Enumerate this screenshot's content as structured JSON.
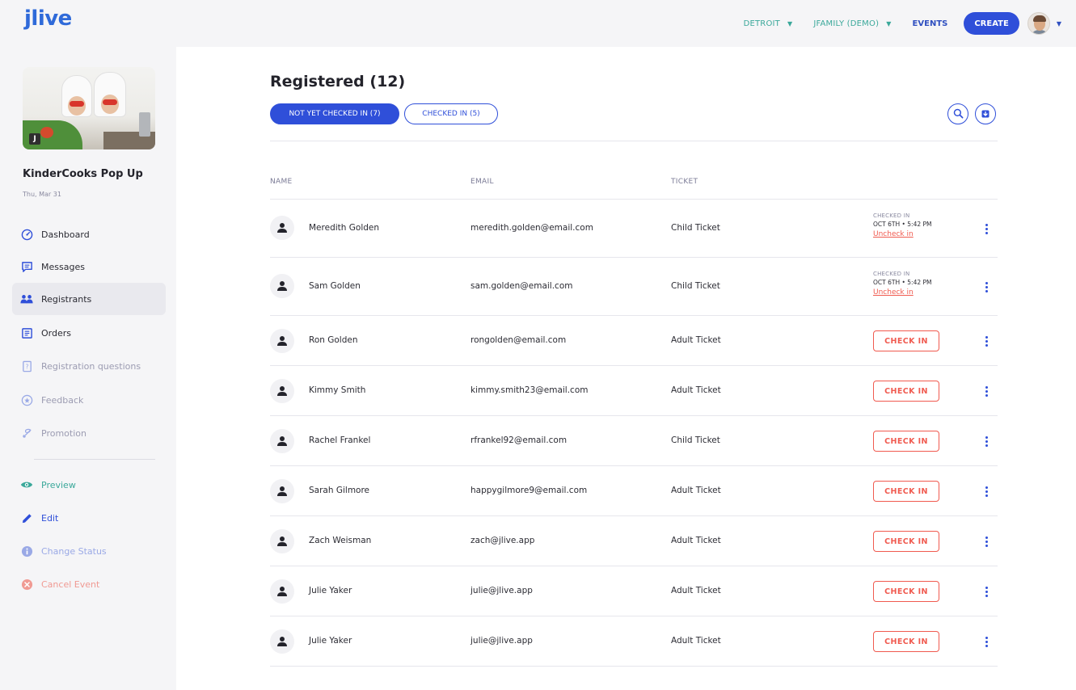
{
  "header": {
    "logo": "jlive",
    "city_label": "DETROIT",
    "account_label": "JFAMILY (DEMO)",
    "events_label": "EVENTS",
    "create_label": "CREATE"
  },
  "sidebar": {
    "event_title": "KinderCooks Pop Up",
    "event_date": "Thu, Mar 31",
    "image_badge": "J",
    "items": [
      {
        "label": "Dashboard",
        "icon": "dashboard-icon"
      },
      {
        "label": "Messages",
        "icon": "message-icon"
      },
      {
        "label": "Registrants",
        "icon": "people-icon",
        "active": true
      },
      {
        "label": "Orders",
        "icon": "orders-icon"
      },
      {
        "label": "Registration questions",
        "icon": "question-icon"
      },
      {
        "label": "Feedback",
        "icon": "feedback-icon"
      },
      {
        "label": "Promotion",
        "icon": "promotion-icon"
      }
    ],
    "actions": [
      {
        "label": "Preview",
        "icon": "eye-icon",
        "color": "#3aa89a"
      },
      {
        "label": "Edit",
        "icon": "pencil-icon",
        "color": "#2f4fd9"
      },
      {
        "label": "Change Status",
        "icon": "info-icon",
        "color": "#9aa9e6"
      },
      {
        "label": "Cancel Event",
        "icon": "cancel-icon",
        "color": "#f09a93"
      }
    ]
  },
  "main": {
    "title": "Registered (12)",
    "tabs": {
      "not_checked_in": "NOT YET CHECKED IN (7)",
      "checked_in": "CHECKED IN (5)"
    },
    "columns": {
      "name": "NAME",
      "email": "EMAIL",
      "ticket": "TICKET"
    },
    "checkin_label": "CHECK IN",
    "checked_in_label": "CHECKED IN",
    "uncheck_label": "Uncheck in",
    "rows": [
      {
        "name": "Meredith Golden",
        "email": "meredith.golden@email.com",
        "ticket": "Child Ticket",
        "status": "checked",
        "checked_at": "OCT 6TH • 5:42 PM"
      },
      {
        "name": "Sam Golden",
        "email": "sam.golden@email.com",
        "ticket": "Child Ticket",
        "status": "checked",
        "checked_at": "OCT 6TH • 5:42 PM"
      },
      {
        "name": "Ron Golden",
        "email": "rongolden@email.com",
        "ticket": "Adult Ticket",
        "status": "pending"
      },
      {
        "name": "Kimmy Smith",
        "email": "kimmy.smith23@email.com",
        "ticket": "Adult Ticket",
        "status": "pending"
      },
      {
        "name": "Rachel Frankel",
        "email": "rfrankel92@email.com",
        "ticket": "Child Ticket",
        "status": "pending"
      },
      {
        "name": "Sarah Gilmore",
        "email": "happygilmore9@email.com",
        "ticket": "Adult Ticket",
        "status": "pending"
      },
      {
        "name": "Zach Weisman",
        "email": "zach@jlive.app",
        "ticket": "Adult Ticket",
        "status": "pending"
      },
      {
        "name": "Julie Yaker",
        "email": "julie@jlive.app",
        "ticket": "Adult Ticket",
        "status": "pending"
      },
      {
        "name": "Julie Yaker",
        "email": "julie@jlive.app",
        "ticket": "Adult Ticket",
        "status": "pending"
      }
    ]
  },
  "colors": {
    "brand_blue": "#2f4fd9",
    "teal": "#3aa89a",
    "checkin_red": "#f05a4f"
  }
}
